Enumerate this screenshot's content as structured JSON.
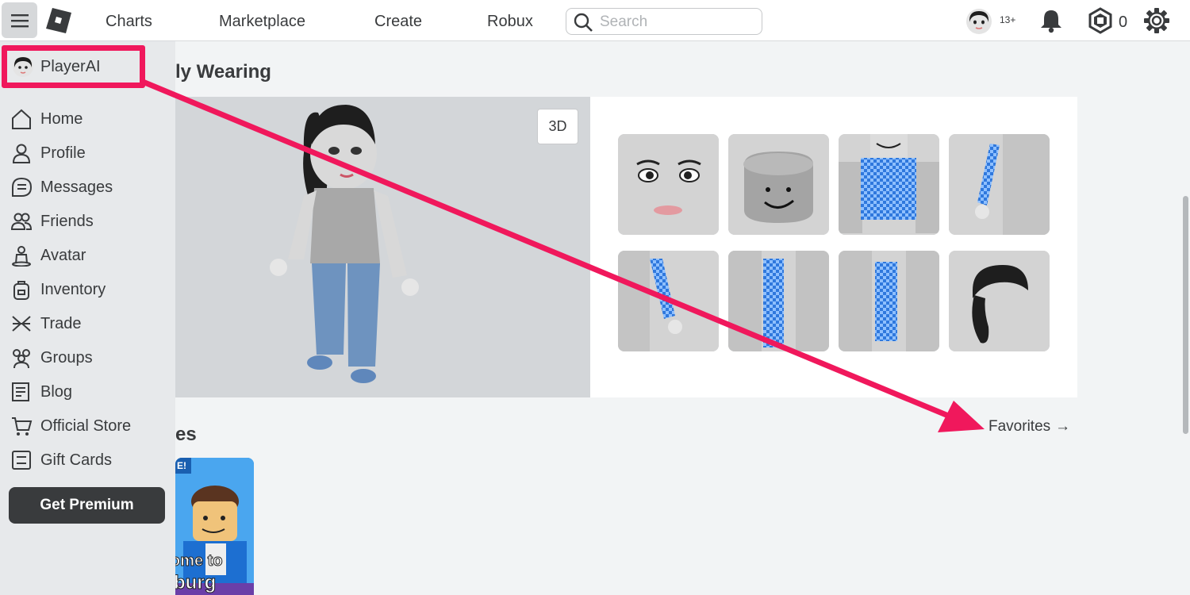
{
  "topbar": {
    "nav": [
      "Charts",
      "Marketplace",
      "Create",
      "Robux"
    ],
    "search_placeholder": "Search",
    "age_badge": "13+",
    "robux_count": "0"
  },
  "sidebar": {
    "username": "PlayerAI",
    "items": [
      {
        "label": "Home",
        "icon": "home-icon"
      },
      {
        "label": "Profile",
        "icon": "profile-icon"
      },
      {
        "label": "Messages",
        "icon": "messages-icon"
      },
      {
        "label": "Friends",
        "icon": "friends-icon"
      },
      {
        "label": "Avatar",
        "icon": "avatar-icon"
      },
      {
        "label": "Inventory",
        "icon": "inventory-icon"
      },
      {
        "label": "Trade",
        "icon": "trade-icon"
      },
      {
        "label": "Groups",
        "icon": "groups-icon"
      },
      {
        "label": "Blog",
        "icon": "blog-icon"
      },
      {
        "label": "Official Store",
        "icon": "store-icon"
      },
      {
        "label": "Gift Cards",
        "icon": "gift-card-icon"
      }
    ],
    "premium_label": "Get Premium"
  },
  "main": {
    "wearing_title": "ly Wearing",
    "view_3d_label": "3D",
    "favorites_label": "Favorites",
    "section2_title": "es",
    "game_card": {
      "top_text": "E!",
      "caption_1": "ome to",
      "caption_2": "burg"
    }
  },
  "colors": {
    "annotation": "#f0185c",
    "sidebar_bg": "#e7e9eb",
    "premium_bg": "#393b3d"
  }
}
